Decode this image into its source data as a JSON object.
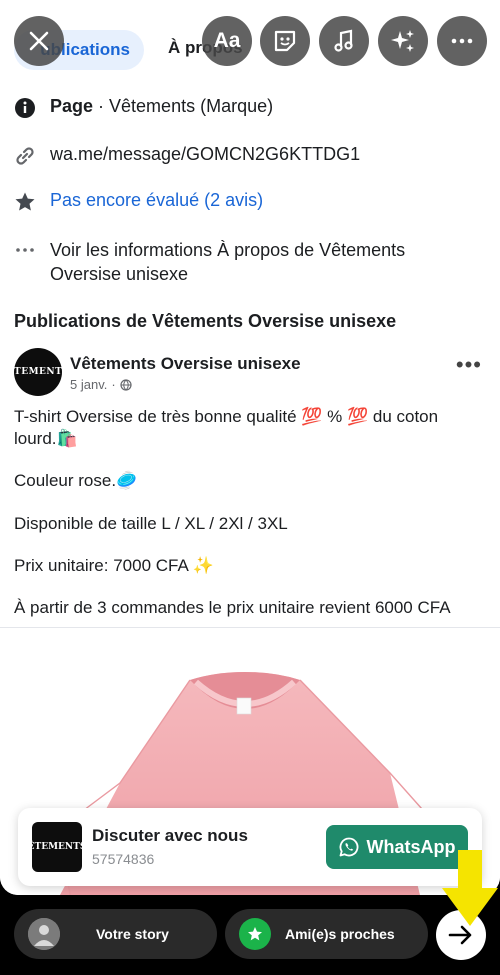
{
  "tabs": {
    "active": "ublications",
    "next": "À propos"
  },
  "overlay": {
    "close": "close-icon",
    "text_tool": "Aa",
    "sticker": "sticker-icon",
    "music": "music-icon",
    "effects": "sparkles-icon",
    "more": "more-icon"
  },
  "info": {
    "page_label": "Page",
    "page_sep": " · ",
    "page_category": "Vêtements (Marque)",
    "link": "wa.me/message/GOMCN2G6KTTDG1",
    "rating": "Pas encore évalué (2 avis)",
    "about_line1": "Voir les informations À propos de Vêtements",
    "about_line2": "Oversise unisexe"
  },
  "section_title": "Publications de Vêtements Oversise unisexe",
  "post": {
    "avatar_text": "ÊTEMENTS",
    "author": "Vêtements Oversise unisexe",
    "date": "5 janv.",
    "dot": "·",
    "more": "•••",
    "lines": [
      "T-shirt Oversise de très bonne qualité 💯 % 💯 du coton",
      "lourd.🛍️",
      "Couleur rose.🥏",
      "Disponible de taille L / XL / 2Xl / 3XL",
      "Prix unitaire: 7000 CFA ✨",
      "À partir de 3 commandes le prix unitaire revient 6000 CFA"
    ]
  },
  "chat_card": {
    "logo_text": "ÊTEMENTS",
    "title": "Discuter avec nous",
    "subtitle": "57574836",
    "button": "WhatsApp"
  },
  "bottom": {
    "your_story": "Votre story",
    "close_friends": "Ami(e)s proches"
  },
  "colors": {
    "accent_blue": "#1a66d6",
    "whatsapp_green": "#1f8a6b",
    "shirt_pink": "#f3b1b6",
    "highlight_yellow": "#f5e400"
  }
}
